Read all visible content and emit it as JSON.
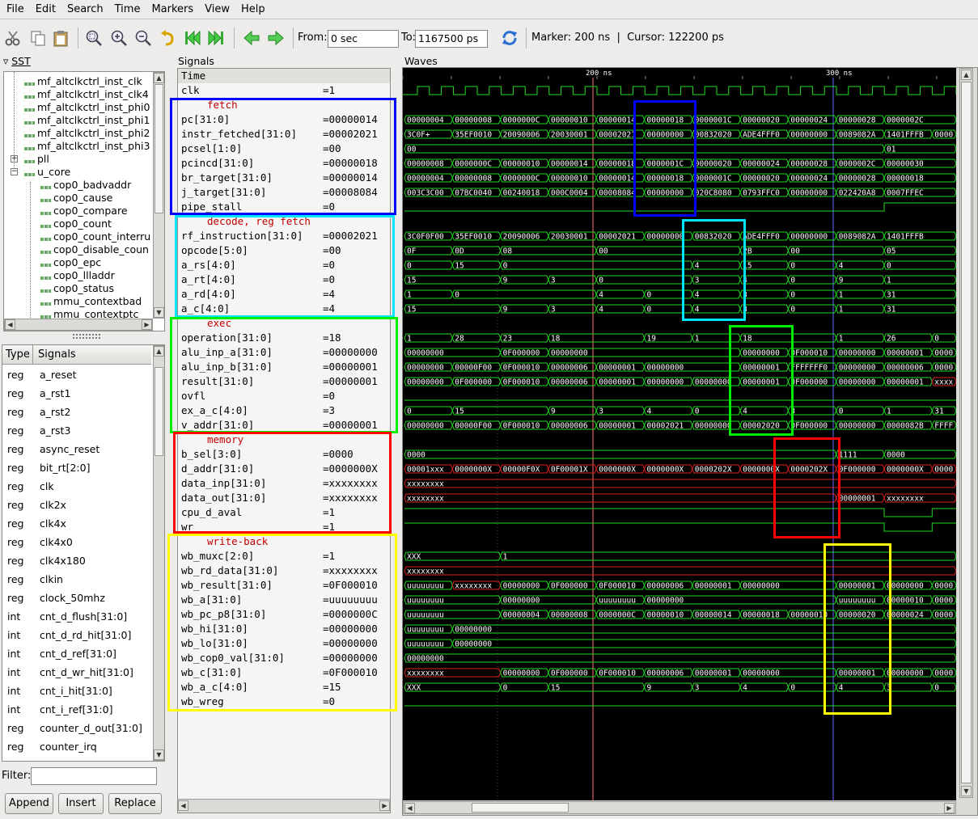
{
  "menu": [
    "File",
    "Edit",
    "Search",
    "Time",
    "Markers",
    "View",
    "Help"
  ],
  "toolbar": {
    "from_label": "From:",
    "from_value": "0 sec",
    "to_label": "To:",
    "to_value": "1167500 ps",
    "status": "Marker: 200 ns  |  Cursor: 122200 ps"
  },
  "sst": {
    "title": "SST",
    "items": [
      "mf_altclkctrl_inst_clk",
      "mf_altclkctrl_inst_clk4",
      "mf_altclkctrl_inst_phi0",
      "mf_altclkctrl_inst_phi1",
      "mf_altclkctrl_inst_phi2",
      "mf_altclkctrl_inst_phi3",
      "pll",
      "u_core",
      "cop0_badvaddr",
      "cop0_cause",
      "cop0_compare",
      "cop0_count",
      "cop0_count_interru",
      "cop0_disable_coun",
      "cop0_epc",
      "cop0_llladdr",
      "cop0_status",
      "mmu_contextbad",
      "mmu_contextptc"
    ]
  },
  "type_signals": {
    "col_type": "Type",
    "col_signals": "Signals",
    "rows": [
      [
        "reg",
        "a_reset"
      ],
      [
        "reg",
        "a_rst1"
      ],
      [
        "reg",
        "a_rst2"
      ],
      [
        "reg",
        "a_rst3"
      ],
      [
        "reg",
        "async_reset"
      ],
      [
        "reg",
        "bit_rt[2:0]"
      ],
      [
        "reg",
        "clk"
      ],
      [
        "reg",
        "clk2x"
      ],
      [
        "reg",
        "clk4x"
      ],
      [
        "reg",
        "clk4x0"
      ],
      [
        "reg",
        "clk4x180"
      ],
      [
        "reg",
        "clkin"
      ],
      [
        "reg",
        "clock_50mhz"
      ],
      [
        "int",
        "cnt_d_flush[31:0]"
      ],
      [
        "int",
        "cnt_d_rd_hit[31:0]"
      ],
      [
        "int",
        "cnt_d_ref[31:0]"
      ],
      [
        "int",
        "cnt_d_wr_hit[31:0]"
      ],
      [
        "int",
        "cnt_i_hit[31:0]"
      ],
      [
        "int",
        "cnt_i_ref[31:0]"
      ],
      [
        "reg",
        "counter_d_out[31:0]"
      ],
      [
        "reg",
        "counter_irq"
      ]
    ],
    "filter_label": "Filter:",
    "append": "Append",
    "insert": "Insert",
    "replace": "Replace"
  },
  "signals": {
    "title": "Signals",
    "time_label": "Time",
    "rows": [
      {
        "n": "clk",
        "v": "=1"
      },
      {
        "n": "fetch",
        "h": true
      },
      {
        "n": "pc[31:0]",
        "v": "=00000014"
      },
      {
        "n": "instr_fetched[31:0]",
        "v": "=00002021"
      },
      {
        "n": "pcsel[1:0]",
        "v": "=00"
      },
      {
        "n": "pcincd[31:0]",
        "v": "=00000018"
      },
      {
        "n": "br_target[31:0]",
        "v": "=00000014"
      },
      {
        "n": "j_target[31:0]",
        "v": "=00008084"
      },
      {
        "n": "pipe_stall",
        "v": "=0"
      },
      {
        "n": "decode, reg fetch",
        "h": true
      },
      {
        "n": "rf_instruction[31:0]",
        "v": "=00002021"
      },
      {
        "n": "opcode[5:0]",
        "v": "=00"
      },
      {
        "n": "a_rs[4:0]",
        "v": "=0"
      },
      {
        "n": "a_rt[4:0]",
        "v": "=0"
      },
      {
        "n": "a_rd[4:0]",
        "v": "=4"
      },
      {
        "n": "a_c[4:0]",
        "v": "=4"
      },
      {
        "n": "exec",
        "h": true
      },
      {
        "n": "operation[31:0]",
        "v": "=18"
      },
      {
        "n": "alu_inp_a[31:0]",
        "v": "=00000000"
      },
      {
        "n": "alu_inp_b[31:0]",
        "v": "=00000001"
      },
      {
        "n": "result[31:0]",
        "v": "=00000001"
      },
      {
        "n": "ovfl",
        "v": "=0"
      },
      {
        "n": "ex_a_c[4:0]",
        "v": "=3"
      },
      {
        "n": "v_addr[31:0]",
        "v": "=00000001"
      },
      {
        "n": "memory",
        "h": true
      },
      {
        "n": "b_sel[3:0]",
        "v": "=0000"
      },
      {
        "n": "d_addr[31:0]",
        "v": "=0000000X"
      },
      {
        "n": "data_inp[31:0]",
        "v": "=xxxxxxxx"
      },
      {
        "n": "data_out[31:0]",
        "v": "=xxxxxxxx"
      },
      {
        "n": "cpu_d_aval",
        "v": "=1"
      },
      {
        "n": "wr",
        "v": "=1"
      },
      {
        "n": "write-back",
        "h": true
      },
      {
        "n": "wb_muxc[2:0]",
        "v": "=1"
      },
      {
        "n": "wb_rd_data[31:0]",
        "v": "=xxxxxxxx"
      },
      {
        "n": "wb_result[31:0]",
        "v": "=0F000010"
      },
      {
        "n": "wb_a[31:0]",
        "v": "=uuuuuuuu"
      },
      {
        "n": "wb_pc_p8[31:0]",
        "v": "=0000000C"
      },
      {
        "n": "wb_hi[31:0]",
        "v": "=00000000"
      },
      {
        "n": "wb_lo[31:0]",
        "v": "=00000000"
      },
      {
        "n": "wb_cop0_val[31:0]",
        "v": "=00000000"
      },
      {
        "n": "wb_c[31:0]",
        "v": "=0F000010"
      },
      {
        "n": "wb_a_c[4:0]",
        "v": "=15"
      },
      {
        "n": "wb_wreg",
        "v": "=0"
      }
    ]
  },
  "waves": {
    "title": "Waves",
    "marker_labels": [
      "200 ns",
      "300 ns"
    ],
    "rows": [
      {
        "k": "clk"
      },
      {
        "k": "e"
      },
      {
        "k": "b",
        "c": "g",
        "s": [
          "00000004",
          "00000008",
          "0000000C",
          "00000010",
          "00000014",
          "00000018",
          "0000001C",
          "00000020",
          "00000024",
          "00000028",
          "0000002C"
        ]
      },
      {
        "k": "b",
        "c": "g",
        "s": [
          "3C0F+",
          "35EF0010",
          "20090006",
          "20030001",
          "00002021",
          "00000000",
          "00832020",
          "ADE4FFF0",
          "00000000",
          "0089082A",
          "1401FFFB",
          "00000000"
        ]
      },
      {
        "k": "b",
        "c": "g",
        "s": [
          "00",
          "",
          "",
          "",
          "",
          "",
          "",
          "",
          "",
          "",
          "01"
        ]
      },
      {
        "k": "b",
        "c": "g",
        "s": [
          "00000008",
          "0000000C",
          "00000010",
          "00000014",
          "00000018",
          "0000001C",
          "00000020",
          "00000024",
          "00000028",
          "0000002C",
          "00000030"
        ]
      },
      {
        "k": "b",
        "c": "g",
        "s": [
          "00000004",
          "00000008",
          "0000000C",
          "00000010",
          "00000014",
          "00000018",
          "0000001C",
          "00000020",
          "00000024",
          "00000028",
          "00000018"
        ]
      },
      {
        "k": "b",
        "c": "g",
        "s": [
          "003C3C00",
          "07BC0040",
          "00240018",
          "000C0004",
          "00008084",
          "00000000",
          "020C8080",
          "0793FFC0",
          "00000000",
          "022420A8",
          "0007FFEC"
        ]
      },
      {
        "k": "l",
        "p": "0000000000111"
      },
      {
        "k": "e"
      },
      {
        "k": "b",
        "c": "g",
        "s": [
          "3C0F0F00",
          "35EF0010",
          "20090006",
          "20030001",
          "00002021",
          "00000000",
          "00832020",
          "ADE4FFF0",
          "00000000",
          "0089082A",
          "1401FFFB"
        ]
      },
      {
        "k": "b",
        "c": "g",
        "s": [
          "0F",
          "0D",
          "08",
          "",
          "00",
          "",
          "",
          "2B",
          "00",
          "",
          "05"
        ]
      },
      {
        "k": "b",
        "c": "g",
        "s": [
          "0",
          "15",
          "0",
          "",
          "",
          "",
          "4",
          "15",
          "0",
          "4",
          "0"
        ]
      },
      {
        "k": "b",
        "c": "g",
        "s": [
          "15",
          "",
          "9",
          "3",
          "0",
          "",
          "3",
          "4",
          "0",
          "9",
          "1"
        ]
      },
      {
        "k": "b",
        "c": "g",
        "s": [
          "1",
          "0",
          "",
          "",
          "4",
          "0",
          "4",
          "3",
          "0",
          "1",
          "31"
        ]
      },
      {
        "k": "b",
        "c": "g",
        "s": [
          "15",
          "",
          "9",
          "3",
          "4",
          "0",
          "4",
          "3",
          "0",
          "1",
          "31"
        ]
      },
      {
        "k": "e"
      },
      {
        "k": "b",
        "c": "g",
        "s": [
          "1",
          "28",
          "23",
          "18",
          "",
          "19",
          "1",
          "18",
          "",
          "1",
          "26",
          "0"
        ]
      },
      {
        "k": "b",
        "c": "g",
        "s": [
          "00000000",
          "",
          "0F000000",
          "00000000",
          "",
          "",
          "",
          "00000000",
          "0F000010",
          "00000000",
          "00000001",
          "00000000"
        ]
      },
      {
        "k": "b",
        "c": "g",
        "s": [
          "00000000",
          "00000F00",
          "0F000010",
          "00000006",
          "00000001",
          "00000000",
          "",
          "00000001",
          "FFFFFFF0",
          "00000000",
          "00000006",
          "00000000"
        ]
      },
      {
        "k": "b",
        "c": "g",
        "s": [
          "00000000",
          "0F000000",
          "0F000010",
          "00000006",
          "00000001",
          "00000000",
          "00000000",
          "00000001",
          "0F000000",
          "00000000",
          "00000001",
          "xxxxxx"
        ]
      },
      {
        "k": "l",
        "p": "000000000000"
      },
      {
        "k": "b",
        "c": "g",
        "s": [
          "0",
          "15",
          "",
          "9",
          "3",
          "4",
          "0",
          "4",
          "3",
          "0",
          "1",
          "31"
        ]
      },
      {
        "k": "b",
        "c": "g",
        "s": [
          "00000000",
          "00000F00",
          "0F000010",
          "00000006",
          "00000001",
          "00002021",
          "00000000",
          "00002020",
          "0F000000",
          "00000000",
          "0000082B",
          "FFFFF"
        ]
      },
      {
        "k": "e"
      },
      {
        "k": "b",
        "c": "g",
        "s": [
          "0000",
          "",
          "",
          "",
          "",
          "",
          "",
          "",
          "",
          "1111",
          "0000"
        ]
      },
      {
        "k": "b",
        "c": "r",
        "s": [
          "00001xxx",
          "0000000X",
          "00000F0X",
          "0F00001X",
          "0000000X",
          "0000000X",
          "0000202X",
          "0000000X",
          "0000202X",
          "0F000000",
          "0000000X",
          "0000"
        ]
      },
      {
        "k": "b",
        "c": "r",
        "s": [
          "xxxxxxxx"
        ]
      },
      {
        "k": "b",
        "c": "r",
        "s": [
          "xxxxxxxx",
          "",
          "",
          "",
          "",
          "",
          "",
          "",
          "",
          "00000001",
          "xxxxxxxx"
        ]
      },
      {
        "k": "l",
        "p": "1111111111011"
      },
      {
        "k": "l",
        "p": "1111111111011"
      },
      {
        "k": "e"
      },
      {
        "k": "b",
        "c": "g",
        "s": [
          "XXX",
          "",
          "1"
        ]
      },
      {
        "k": "b",
        "c": "r",
        "s": [
          "xxxxxxxx"
        ]
      },
      {
        "k": "b",
        "c": "g",
        "s": [
          "uuuuuuuu",
          "xxxxxxxx",
          "00000000",
          "0F000000",
          "0F000010",
          "00000006",
          "00000001",
          "00000000",
          "",
          "00000001",
          "00000000",
          "00000"
        ]
      },
      {
        "k": "b",
        "c": "g",
        "s": [
          "uuuuuuuu",
          "",
          "00000000",
          "",
          "uuuuuuuu",
          "00000000",
          "",
          "",
          "",
          "uuuuuuuu",
          "00000010",
          "00000"
        ]
      },
      {
        "k": "b",
        "c": "g",
        "s": [
          "uuuuuuuu",
          "",
          "00000004",
          "00000008",
          "0000000C",
          "00000010",
          "00000014",
          "00000018",
          "00000010",
          "00000020",
          "00000024",
          "00000"
        ]
      },
      {
        "k": "b",
        "c": "g",
        "s": [
          "uuuuuuuu",
          "00000000"
        ]
      },
      {
        "k": "b",
        "c": "g",
        "s": [
          "uuuuuuuu",
          "00000000"
        ]
      },
      {
        "k": "b",
        "c": "g",
        "s": [
          "00000000"
        ]
      },
      {
        "k": "b",
        "c": "g",
        "s": [
          "xxxxxxxx",
          "",
          "00000000",
          "0F000000",
          "0F000010",
          "00000006",
          "00000001",
          "00000000",
          "",
          "00000001",
          "00000000",
          "00000"
        ]
      },
      {
        "k": "b",
        "c": "g",
        "s": [
          "XXX",
          "",
          "0",
          "15",
          "",
          "9",
          "3",
          "4",
          "0",
          "4",
          "3",
          "0"
        ]
      },
      {
        "k": "l",
        "p": "00000000000011"
      }
    ]
  },
  "colors": {
    "wave": "#22dd22",
    "wave_x": "#dd2222",
    "marker": "#ff7070",
    "cursor": "#6666ff",
    "fetch": "#0000ff",
    "decode": "#00e5ff",
    "exec": "#00ee00",
    "memory": "#ff0000",
    "writeback": "#ffff00"
  }
}
